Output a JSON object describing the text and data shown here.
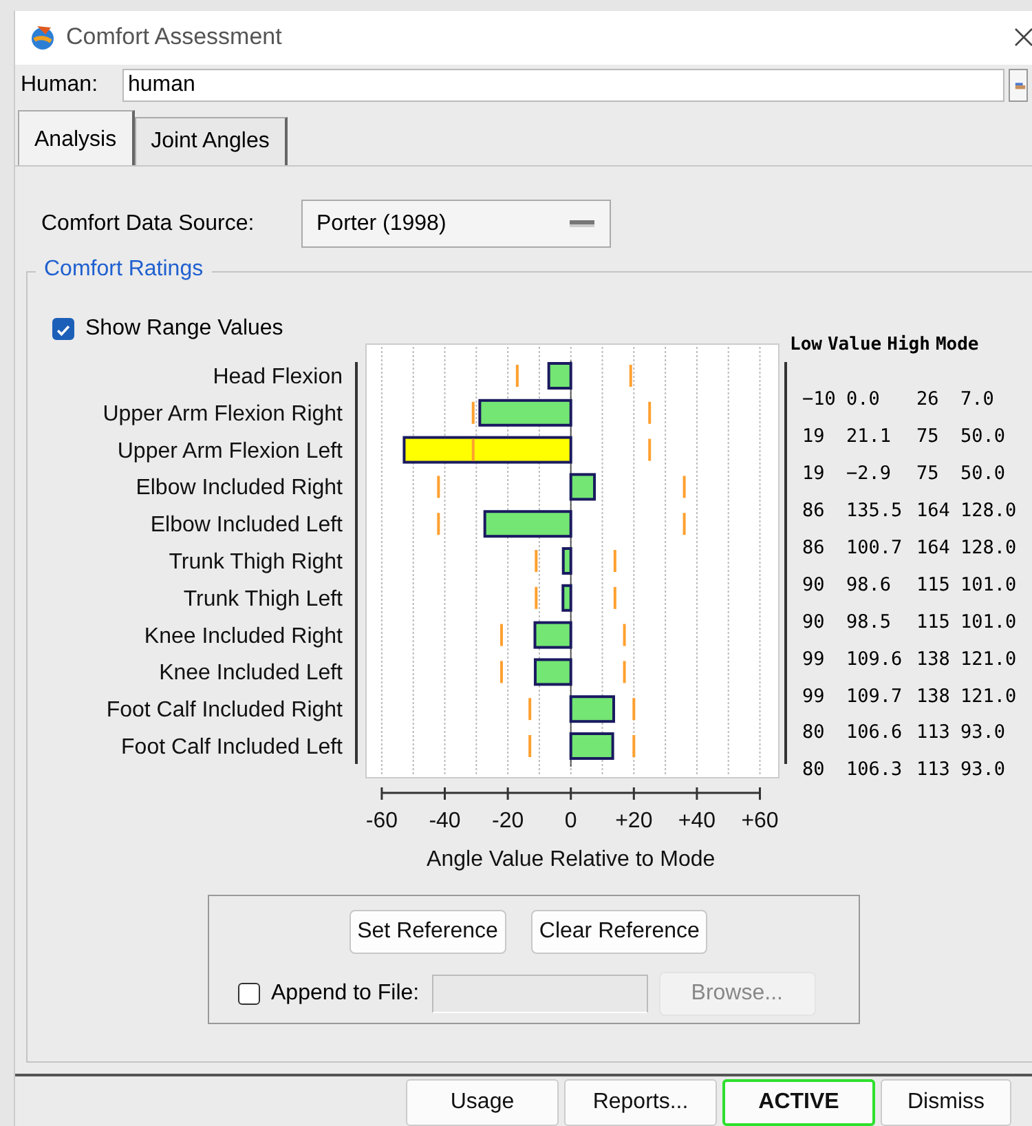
{
  "window": {
    "title": "Comfort Assessment"
  },
  "human": {
    "label": "Human:",
    "value": "human"
  },
  "tabs": [
    {
      "label": "Analysis",
      "selected": true
    },
    {
      "label": "Joint Angles",
      "selected": false
    }
  ],
  "data_source": {
    "label": "Comfort Data Source:",
    "value": "Porter (1998)"
  },
  "comfort_ratings": {
    "title": "Comfort Ratings",
    "show_range_values": {
      "label": "Show Range Values",
      "checked": true
    },
    "table": {
      "columns": [
        "Low",
        "Value",
        "High",
        "Mode"
      ],
      "rows": [
        [
          "−10",
          "0.0",
          "26",
          "7.0"
        ],
        [
          "19",
          "21.1",
          "75",
          "50.0"
        ],
        [
          "19",
          "−2.9",
          "75",
          "50.0"
        ],
        [
          "86",
          "135.5",
          "164",
          "128.0"
        ],
        [
          "86",
          "100.7",
          "164",
          "128.0"
        ],
        [
          "90",
          "98.6",
          "115",
          "101.0"
        ],
        [
          "90",
          "98.5",
          "115",
          "101.0"
        ],
        [
          "99",
          "109.6",
          "138",
          "121.0"
        ],
        [
          "99",
          "109.7",
          "138",
          "121.0"
        ],
        [
          "80",
          "106.6",
          "113",
          "93.0"
        ],
        [
          "80",
          "106.3",
          "113",
          "93.0"
        ]
      ]
    },
    "chart_data": {
      "type": "bar",
      "orientation": "horizontal",
      "xlabel": "Angle Value Relative to Mode",
      "stacked": true,
      "categories": [
        "Head Flexion",
        "Upper Arm Flexion Right",
        "Upper Arm Flexion Left",
        "Elbow Included Right",
        "Elbow Included Left",
        "Trunk Thigh Right",
        "Trunk Thigh Left",
        "Knee Included Right",
        "Knee Included Left",
        "Foot Calf Included Right",
        "Foot Calf Included Left"
      ],
      "series": [
        {
          "color": "#73e673",
          "values": [
            -7,
            -28.9,
            null,
            7.5,
            -27.3,
            -2.4,
            -2.5,
            -11.4,
            -11.3,
            13.6,
            13.3
          ]
        },
        {
          "color": "#ffff00",
          "values": [
            null,
            null,
            -52.9,
            null,
            null,
            null,
            null,
            null,
            null,
            null,
            null
          ]
        }
      ],
      "xlim": [
        -65,
        66
      ],
      "grid": true,
      "xticks": [
        {
          "value": -60,
          "label": "-60"
        },
        {
          "value": -40,
          "label": "-40"
        },
        {
          "value": -20,
          "label": "-20"
        },
        {
          "value": 0,
          "label": "0"
        },
        {
          "value": 20,
          "label": "+20"
        },
        {
          "value": 40,
          "label": "+40"
        },
        {
          "value": 60,
          "label": "+60"
        }
      ]
    }
  },
  "reference": {
    "buttons": [
      "Set Reference",
      "Clear Reference"
    ],
    "append": {
      "label": "Append to File:",
      "checked": false
    },
    "browse": {
      "label": "Browse...",
      "disabled": true
    }
  },
  "footer_buttons": [
    {
      "label": "Usage",
      "selected": false
    },
    {
      "label": "Reports...",
      "selected": false
    },
    {
      "label": "ACTIVE",
      "selected": true
    },
    {
      "label": "Dismiss",
      "selected": false
    }
  ]
}
